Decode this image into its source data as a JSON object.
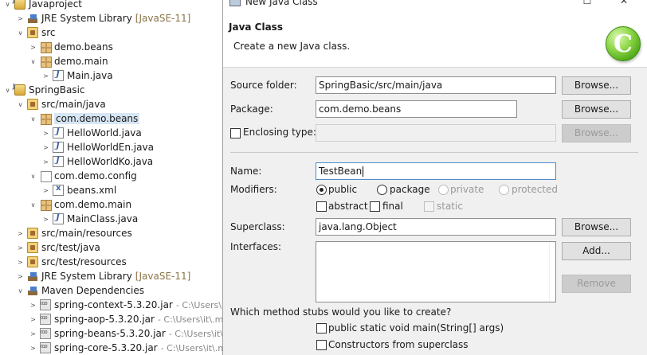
{
  "explorer": {
    "items": [
      {
        "label": "Javaproject",
        "decoration": "",
        "icon": "java-project-icon",
        "expanded": true
      },
      {
        "label": "JRE System Library",
        "decoration": "[JavaSE-11]",
        "icon": "library-icon",
        "expanded": false
      },
      {
        "label": "src",
        "decoration": "",
        "icon": "source-folder-icon",
        "expanded": true
      },
      {
        "label": "demo.beans",
        "decoration": "",
        "icon": "package-icon",
        "expanded": false
      },
      {
        "label": "demo.main",
        "decoration": "",
        "icon": "package-icon",
        "expanded": true
      },
      {
        "label": "Main.java",
        "decoration": "",
        "icon": "java-file-icon",
        "expanded": false
      },
      {
        "label": "SpringBasic",
        "decoration": "",
        "icon": "java-project-icon",
        "expanded": true
      },
      {
        "label": "src/main/java",
        "decoration": "",
        "icon": "source-folder-icon",
        "expanded": true
      },
      {
        "label": "com.demo.beans",
        "decoration": "",
        "icon": "package-icon",
        "expanded": true
      },
      {
        "label": "HelloWorld.java",
        "decoration": "",
        "icon": "java-file-icon",
        "expanded": false
      },
      {
        "label": "HelloWorldEn.java",
        "decoration": "",
        "icon": "java-file-icon",
        "expanded": false
      },
      {
        "label": "HelloWorldKo.java",
        "decoration": "",
        "icon": "java-file-icon",
        "expanded": false
      },
      {
        "label": "com.demo.config",
        "decoration": "",
        "icon": "package-icon",
        "expanded": true
      },
      {
        "label": "beans.xml",
        "decoration": "",
        "icon": "xml-file-icon",
        "expanded": false
      },
      {
        "label": "com.demo.main",
        "decoration": "",
        "icon": "package-icon",
        "expanded": true
      },
      {
        "label": "MainClass.java",
        "decoration": "",
        "icon": "java-file-icon",
        "expanded": false
      },
      {
        "label": "src/main/resources",
        "decoration": "",
        "icon": "source-folder-icon",
        "expanded": false
      },
      {
        "label": "src/test/java",
        "decoration": "",
        "icon": "source-folder-icon",
        "expanded": false
      },
      {
        "label": "src/test/resources",
        "decoration": "",
        "icon": "source-folder-icon",
        "expanded": false
      },
      {
        "label": "JRE System Library",
        "decoration": "[JavaSE-11]",
        "icon": "library-icon",
        "expanded": false
      },
      {
        "label": "Maven Dependencies",
        "decoration": "",
        "icon": "library-icon",
        "expanded": true
      },
      {
        "label": "spring-context-5.3.20.jar",
        "decoration": "- C:\\Users\\it\\",
        "icon": "jar-icon",
        "expanded": false
      },
      {
        "label": "spring-aop-5.3.20.jar",
        "decoration": "- C:\\Users\\it\\.m",
        "icon": "jar-icon",
        "expanded": false
      },
      {
        "label": "spring-beans-5.3.20.jar",
        "decoration": "- C:\\Users\\it\\",
        "icon": "jar-icon",
        "expanded": false
      },
      {
        "label": "spring-core-5.3.20.jar",
        "decoration": "- C:\\Users\\it\\.m",
        "icon": "jar-icon",
        "expanded": false
      }
    ]
  },
  "dialog": {
    "window_title": "New Java Class",
    "banner_title": "Java Class",
    "banner_description": "Create a new Java class.",
    "source_folder": {
      "label": "Source folder:",
      "value": "SpringBasic/src/main/java",
      "button": "Browse..."
    },
    "package": {
      "label": "Package:",
      "value": "com.demo.beans",
      "button": "Browse..."
    },
    "enclosing_type": {
      "label": "Enclosing type:",
      "value": "",
      "button": "Browse...",
      "checked": false
    },
    "name": {
      "label": "Name:",
      "value": "TestBean"
    },
    "modifiers": {
      "label": "Modifiers:",
      "access": [
        {
          "label": "public",
          "selected": true,
          "enabled": true
        },
        {
          "label": "package",
          "selected": false,
          "enabled": true
        },
        {
          "label": "private",
          "selected": false,
          "enabled": false
        },
        {
          "label": "protected",
          "selected": false,
          "enabled": false
        }
      ],
      "flags": [
        {
          "label": "abstract",
          "checked": false,
          "enabled": true
        },
        {
          "label": "final",
          "checked": false,
          "enabled": true
        },
        {
          "label": "static",
          "checked": false,
          "enabled": false
        }
      ]
    },
    "superclass": {
      "label": "Superclass:",
      "value": "java.lang.Object",
      "button": "Browse..."
    },
    "interfaces": {
      "label": "Interfaces:",
      "add_button": "Add...",
      "remove_button": "Remove"
    },
    "stubs": {
      "question": "Which method stubs would you like to create?",
      "options": [
        {
          "label": "public static void main(String[] args)",
          "checked": false
        },
        {
          "label": "Constructors from superclass",
          "checked": false
        }
      ]
    }
  }
}
